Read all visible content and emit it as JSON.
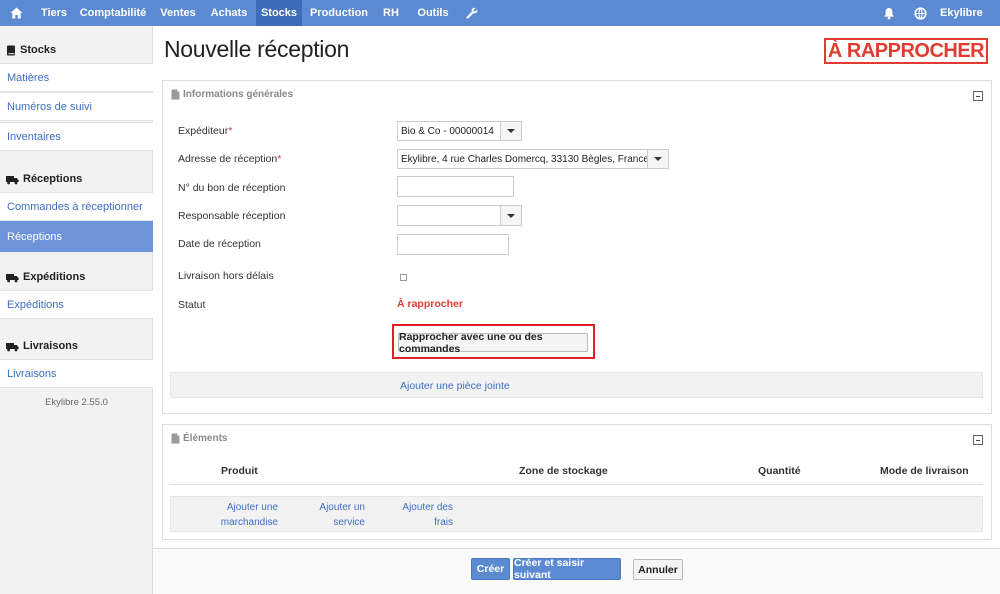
{
  "nav": {
    "items": [
      "Tiers",
      "Comptabilité",
      "Ventes",
      "Achats",
      "Stocks",
      "Production",
      "RH",
      "Outils"
    ],
    "active": "Stocks",
    "user": "Ekylibre"
  },
  "sidebar": {
    "stocks_title": "Stocks",
    "stocks_items": [
      "Matières",
      "Numéros de suivi",
      "Inventaires"
    ],
    "receptions_title": "Réceptions",
    "receptions_items": [
      "Commandes à réceptionner",
      "Réceptions"
    ],
    "expeditions_title": "Expéditions",
    "expeditions_items": [
      "Expéditions"
    ],
    "livraisons_title": "Livraisons",
    "livraisons_items": [
      "Livraisons"
    ],
    "version": "Ekylibre 2.55.0"
  },
  "page": {
    "title": "Nouvelle réception",
    "stamp": "À RAPPROCHER",
    "stamp_color": "#e03c31"
  },
  "general": {
    "title": "Informations générales",
    "sender_label": "Expéditeur",
    "sender_value": "Bio & Co - 00000014",
    "address_label": "Adresse de réception",
    "address_value": "Ekylibre, 4 rue Charles Domercq, 33130 Bègles, France",
    "number_label": "N° du bon de réception",
    "number_value": "",
    "responsible_label": "Responsable réception",
    "responsible_value": "",
    "date_label": "Date de réception",
    "date_value": "",
    "late_label": "Livraison hors délais",
    "status_label": "Statut",
    "status_value": "À rapprocher",
    "match_button": "Rapprocher avec une ou des commandes",
    "attach_link": "Ajouter une pièce jointe",
    "required_mark": "*"
  },
  "elements": {
    "title": "Éléments",
    "columns": [
      "Produit",
      "Zone de stockage",
      "Quantité",
      "Mode de livraison"
    ],
    "add_links": [
      {
        "line1": "Ajouter une",
        "line2": "marchandise"
      },
      {
        "line1": "Ajouter un",
        "line2": "service"
      },
      {
        "line1": "Ajouter des",
        "line2": "frais"
      }
    ]
  },
  "footer": {
    "create": "Créer",
    "create_next": "Créer et saisir suivant",
    "cancel": "Annuler"
  },
  "colors": {
    "nav_bg": "#5b8ad3",
    "nav_active": "#3f6cb6",
    "link": "#3d6fc1",
    "highlight_box": "#e02020"
  }
}
